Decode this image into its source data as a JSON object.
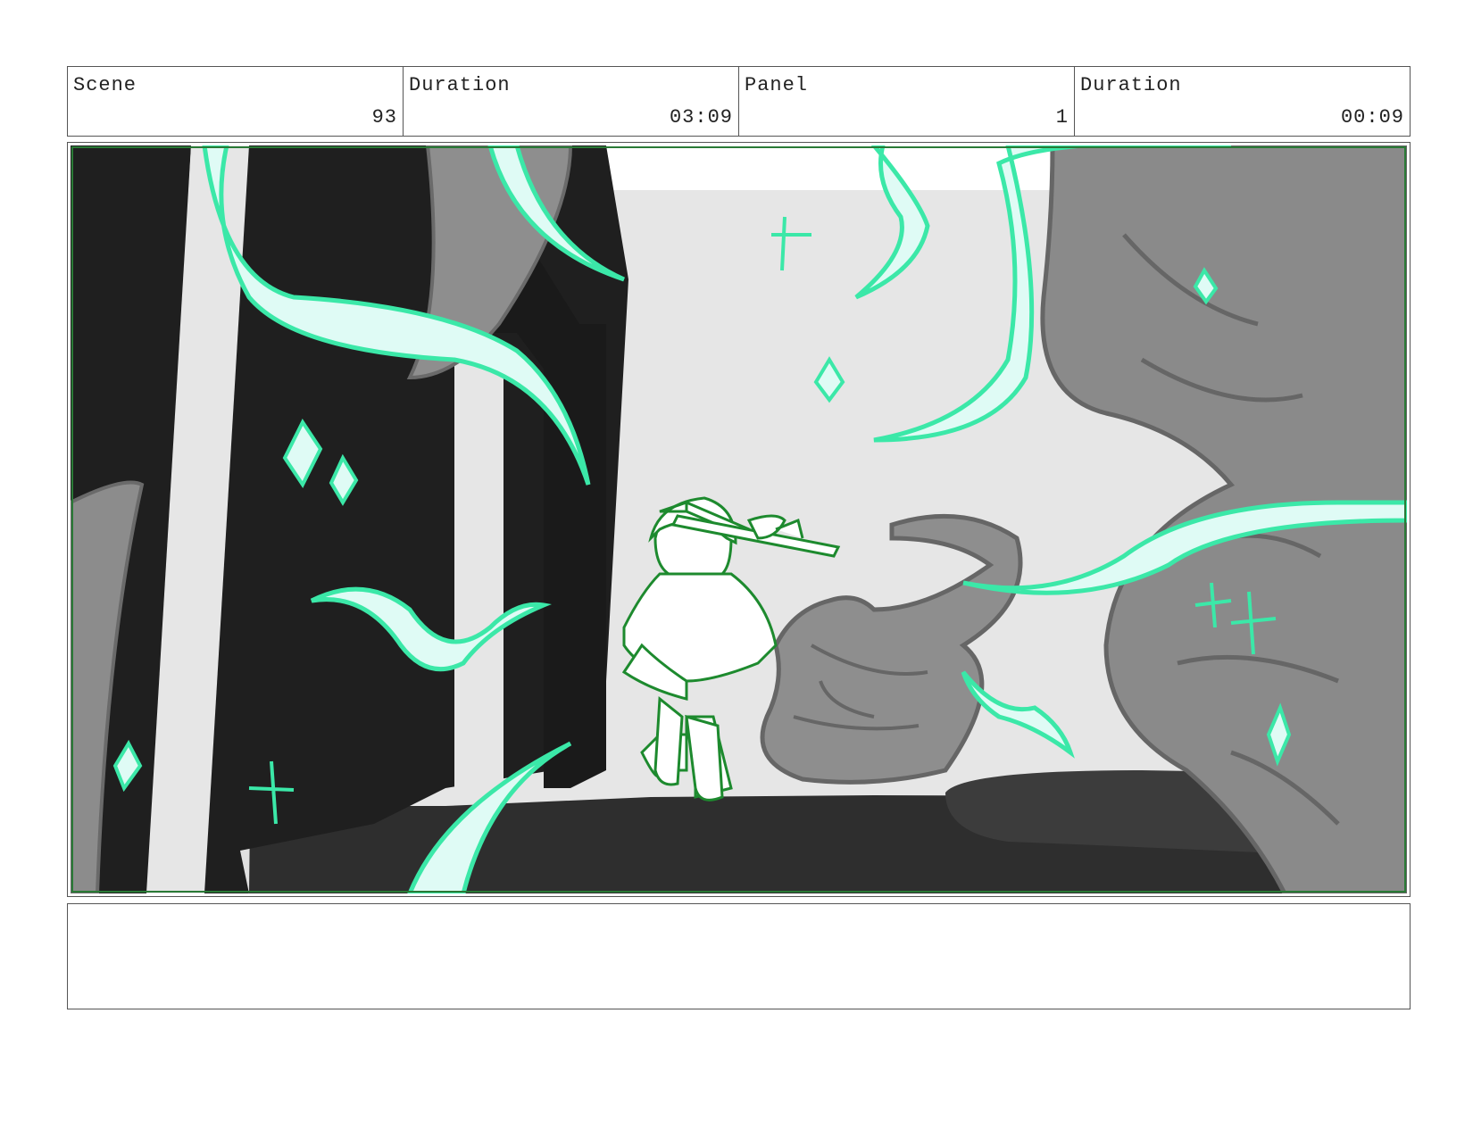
{
  "header": {
    "scene_label": "Scene",
    "scene_value": "93",
    "scene_duration_label": "Duration",
    "scene_duration_value": "03:09",
    "panel_label": "Panel",
    "panel_value": "1",
    "panel_duration_label": "Duration",
    "panel_duration_value": "00:09"
  },
  "colors": {
    "magic_fill": "#dffbf5",
    "magic_stroke": "#3be8a8",
    "character_line": "#1d8a2e",
    "frame_line": "#2a7a36"
  },
  "notes": {
    "text": ""
  }
}
